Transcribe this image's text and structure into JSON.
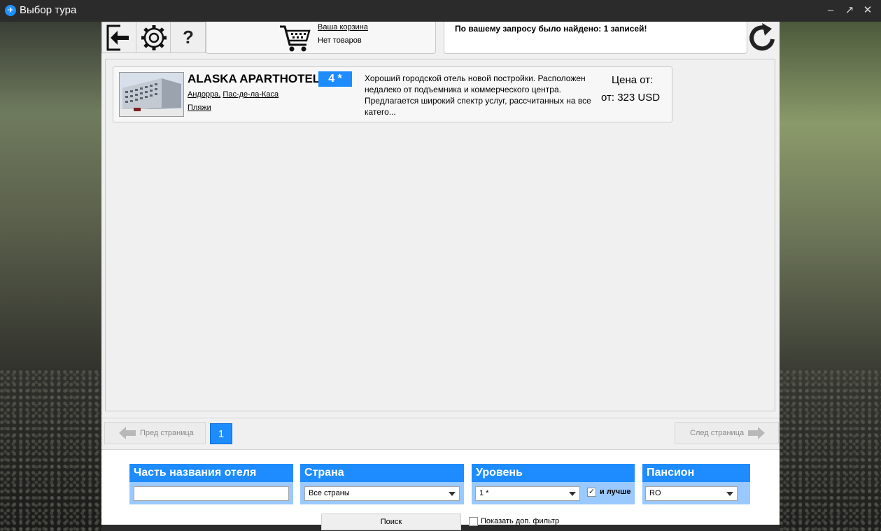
{
  "window": {
    "title": "Выбор тура",
    "controls": [
      "–",
      "↗",
      "✕"
    ]
  },
  "toolbar": {
    "help_label": "?",
    "cart_link": "Ваша корзина",
    "cart_status": "Нет товаров",
    "result_text": "По вашему запросу было найдено: 1 записей!"
  },
  "hotel": {
    "name": "ALASKA APARTHOTEL",
    "stars": "4 *",
    "country": "Андорра,",
    "city": "Пас-де-ла-Каса",
    "category": "Пляжи",
    "description": "Хороший городской отель новой постройки. Расположен недалеко от подъемника и коммерческого центра. Предлагается широкий спектр услуг, рассчитанных на все катего...",
    "price_label": "Цена от:",
    "price_value": "от: 323 USD"
  },
  "pager": {
    "prev_label": "Пред страница",
    "next_label": "След страница",
    "current_page": "1"
  },
  "filters": {
    "hotel_name_label": "Часть названия отеля",
    "hotel_name_value": "",
    "country_label": "Страна",
    "country_value": "Все страны",
    "level_label": "Уровень",
    "level_value": "1 *",
    "better_label": "и лучше",
    "better_checked": true,
    "board_label": "Пансион",
    "board_value": "RO",
    "search_button": "Поиск",
    "extra_filter_label": "Показать доп. фильтр",
    "extra_filter_checked": false
  },
  "colors": {
    "accent": "#1e8cff",
    "accent_light": "#99c9ff"
  }
}
